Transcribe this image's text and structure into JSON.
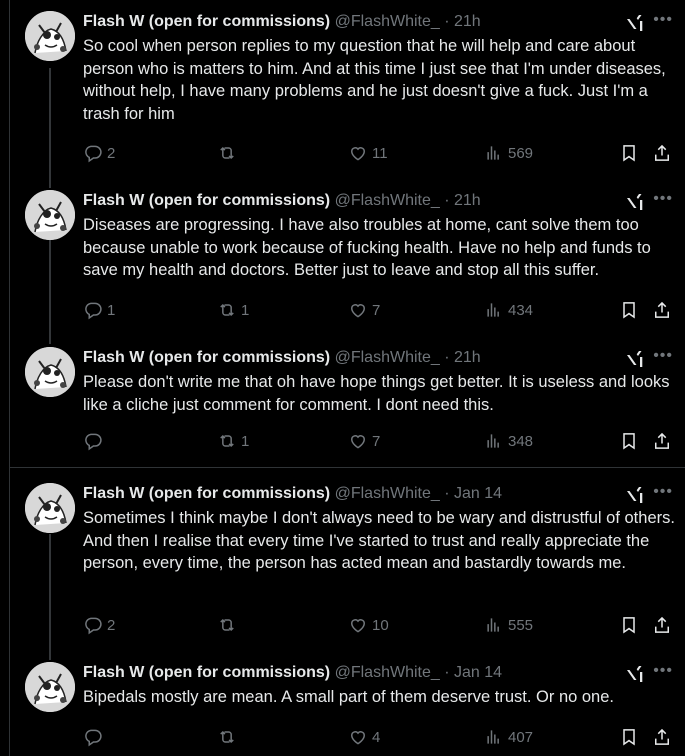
{
  "tweets": [
    {
      "name": "Flash W (open for commissions)",
      "handle": "@FlashWhite_",
      "dot": "·",
      "time": "21h",
      "text": "So cool when person replies to my question that he will help and care about person who is matters to him. And at this time I just see that I'm under diseases, without help, I have many problems and he just doesn't give a fuck. Just I'm a trash for him",
      "replies": "2",
      "retweets": "",
      "likes": "11",
      "views": "569"
    },
    {
      "name": "Flash W (open for commissions)",
      "handle": "@FlashWhite_",
      "dot": "·",
      "time": "21h",
      "text": "Diseases are progressing. I have also troubles at home, cant solve them too because unable to work because of fucking health. Have no help and funds to save my health and doctors. Better just to leave and stop all this suffer.",
      "replies": "1",
      "retweets": "1",
      "likes": "7",
      "views": "434"
    },
    {
      "name": "Flash W (open for commissions)",
      "handle": "@FlashWhite_",
      "dot": "·",
      "time": "21h",
      "text": "Please don't write me that oh have hope things get better. It is useless and looks like a cliche just comment for comment. I dont need this.",
      "replies": "",
      "retweets": "1",
      "likes": "7",
      "views": "348"
    },
    {
      "name": "Flash W (open for commissions)",
      "handle": "@FlashWhite_",
      "dot": "·",
      "time": "Jan 14",
      "text": "Sometimes I think maybe I don't always need to be wary and distrustful of others. And then I realise that every time I've started to trust and really appreciate the person, every time, the person has acted mean and bastardly towards me.",
      "replies": "2",
      "retweets": "",
      "likes": "10",
      "views": "555"
    },
    {
      "name": "Flash W (open for commissions)",
      "handle": "@FlashWhite_",
      "dot": "·",
      "time": "Jan 14",
      "text": "Bipedals mostly are mean. A small part of them deserve trust. Or no one.",
      "replies": "",
      "retweets": "",
      "likes": "4",
      "views": "407"
    }
  ],
  "icons": {
    "reply": "reply-icon",
    "retweet": "retweet-icon",
    "like": "heart-icon",
    "views": "views-icon",
    "bookmark": "bookmark-icon",
    "share": "share-icon",
    "grok": "grok-icon",
    "more": "more-icon"
  },
  "colors": {
    "background": "#000000",
    "text": "#e7e9ea",
    "muted": "#71767b",
    "divider": "#2f3336"
  }
}
